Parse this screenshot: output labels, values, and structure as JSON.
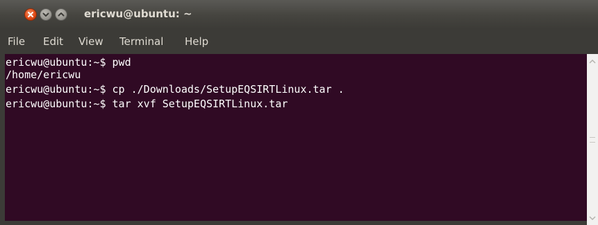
{
  "window": {
    "title": "ericwu@ubuntu: ~",
    "controls": {
      "close_icon": "close-icon",
      "minimize_icon": "minimize-icon",
      "maximize_icon": "maximize-icon",
      "close_color": "#dd4814"
    }
  },
  "menubar": {
    "items": [
      {
        "label": "File"
      },
      {
        "label": "Edit"
      },
      {
        "label": "View"
      },
      {
        "label": "Terminal"
      },
      {
        "label": "Help"
      }
    ]
  },
  "terminal": {
    "background_color": "#300a24",
    "text_color": "#ffffff",
    "lines": [
      "ericwu@ubuntu:~$ pwd",
      "/home/ericwu",
      "ericwu@ubuntu:~$ cp ./Downloads/SetupEQSIRTLinux.tar .",
      "ericwu@ubuntu:~$ tar xvf SetupEQSIRTLinux.tar"
    ]
  },
  "scrollbar": {
    "up_icon": "scroll-up-arrow-icon",
    "down_icon": "scroll-down-arrow-icon"
  }
}
